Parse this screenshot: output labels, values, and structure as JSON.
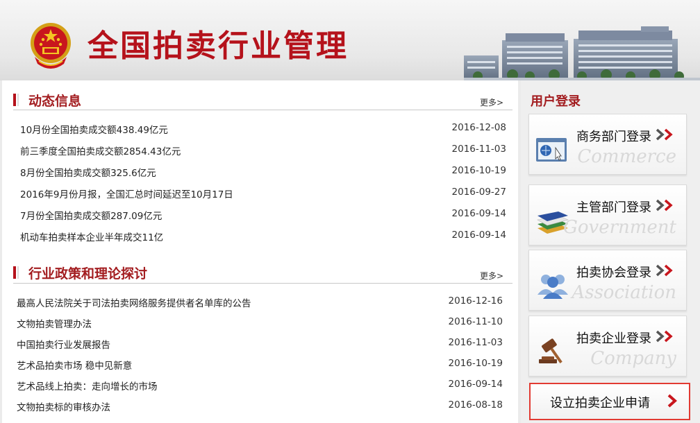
{
  "header": {
    "site_title": "全国拍卖行业管理"
  },
  "news": {
    "title": "动态信息",
    "more": "更多>",
    "items": [
      {
        "title": "10月份全国拍卖成交额438.49亿元",
        "date": "2016-12-08"
      },
      {
        "title": "前三季度全国拍卖成交额2854.43亿元",
        "date": "2016-11-03"
      },
      {
        "title": "8月份全国拍卖成交额325.6亿元",
        "date": "2016-10-19"
      },
      {
        "title": "2016年9月份月报，全国汇总时间延迟至10月17日",
        "date": "2016-09-27"
      },
      {
        "title": "7月份全国拍卖成交额287.09亿元",
        "date": "2016-09-14"
      },
      {
        "title": "机动车拍卖样本企业半年成交11亿",
        "date": "2016-09-14"
      }
    ]
  },
  "policy": {
    "title": "行业政策和理论探讨",
    "more": "更多>",
    "items": [
      {
        "title": "最高人民法院关于司法拍卖网络服务提供者名单库的公告",
        "date": "2016-12-16"
      },
      {
        "title": "文物拍卖管理办法",
        "date": "2016-11-10"
      },
      {
        "title": "中国拍卖行业发展报告",
        "date": "2016-11-03"
      },
      {
        "title": "艺术品拍卖市场 稳中见新意",
        "date": "2016-10-19"
      },
      {
        "title": "艺术品线上拍卖：走向增长的市场",
        "date": "2016-09-14"
      },
      {
        "title": "文物拍卖标的审核办法",
        "date": "2016-08-18"
      }
    ]
  },
  "login": {
    "title": "用户登录",
    "buttons": [
      {
        "label": "商务部门登录",
        "en": "Commerce",
        "icon": "browser-window-icon"
      },
      {
        "label": "主管部门登录",
        "en": "Government",
        "icon": "books-icon"
      },
      {
        "label": "拍卖协会登录",
        "en": "Association",
        "icon": "users-icon"
      },
      {
        "label": "拍卖企业登录",
        "en": "Company",
        "icon": "gavel-icon"
      }
    ],
    "apply_label": "设立拍卖企业申请"
  },
  "colors": {
    "brand_red": "#b5121b",
    "arrow_red": "#c8161d",
    "apply_border": "#e23a32"
  }
}
